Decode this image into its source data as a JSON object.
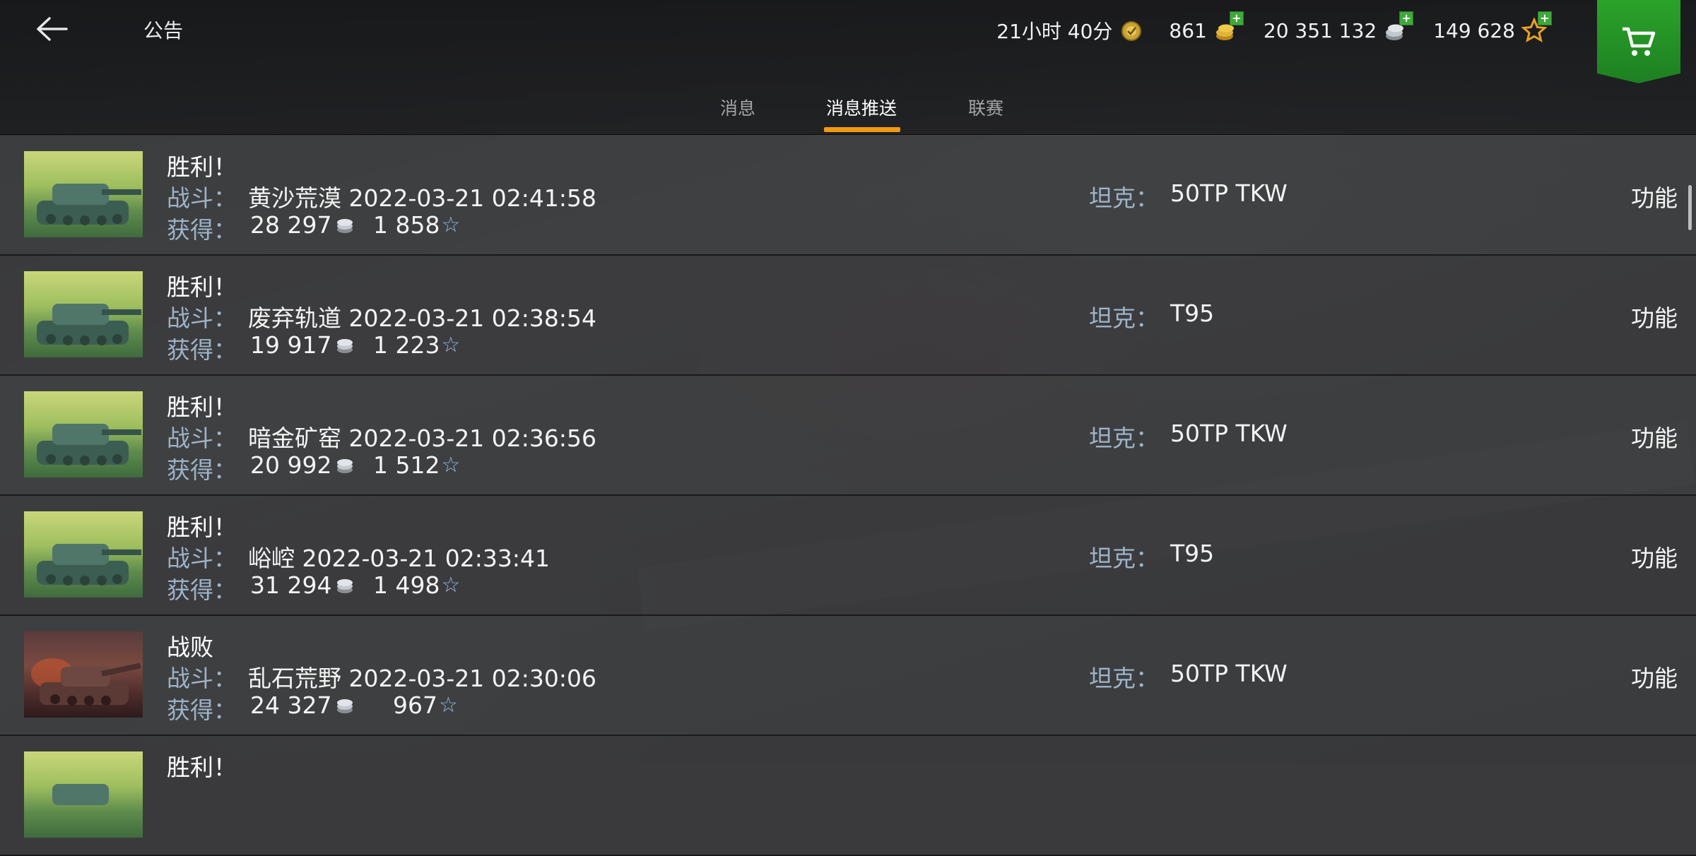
{
  "header": {
    "title": "公告",
    "resources": {
      "premium_time": "21小时 40分",
      "gold": "861",
      "credits": "20 351 132",
      "free_xp": "149 628"
    }
  },
  "tabs": [
    {
      "label": "消息",
      "active": false
    },
    {
      "label": "消息推送",
      "active": true
    },
    {
      "label": "联赛",
      "active": false
    }
  ],
  "labels": {
    "battle": "战斗：",
    "earned": "获得：",
    "tank": "坦克：",
    "function": "功能"
  },
  "messages": [
    {
      "result": "胜利！",
      "battle": "黄沙荒漠 2022-03-21 02:41:58",
      "credits": "28 297",
      "xp": "1 858",
      "tank": "50TP TKW"
    },
    {
      "result": "胜利！",
      "battle": "废弃轨道 2022-03-21 02:38:54",
      "credits": "19 917",
      "xp": "1 223",
      "tank": "T95"
    },
    {
      "result": "胜利！",
      "battle": "暗金矿窑 2022-03-21 02:36:56",
      "credits": "20 992",
      "xp": "1 512",
      "tank": "50TP TKW"
    },
    {
      "result": "胜利！",
      "battle": "峪崆 2022-03-21 02:33:41",
      "credits": "31 294",
      "xp": "1 498",
      "tank": "T95"
    },
    {
      "result": "战败",
      "battle": "乱石荒野 2022-03-21 02:30:06",
      "credits": "24 327",
      "xp": "967",
      "tank": "50TP TKW"
    },
    {
      "result": "胜利！"
    }
  ],
  "colors": {
    "accent": "#f29a12",
    "label": "#9db3c8",
    "shop_green": "#2aa32a"
  }
}
